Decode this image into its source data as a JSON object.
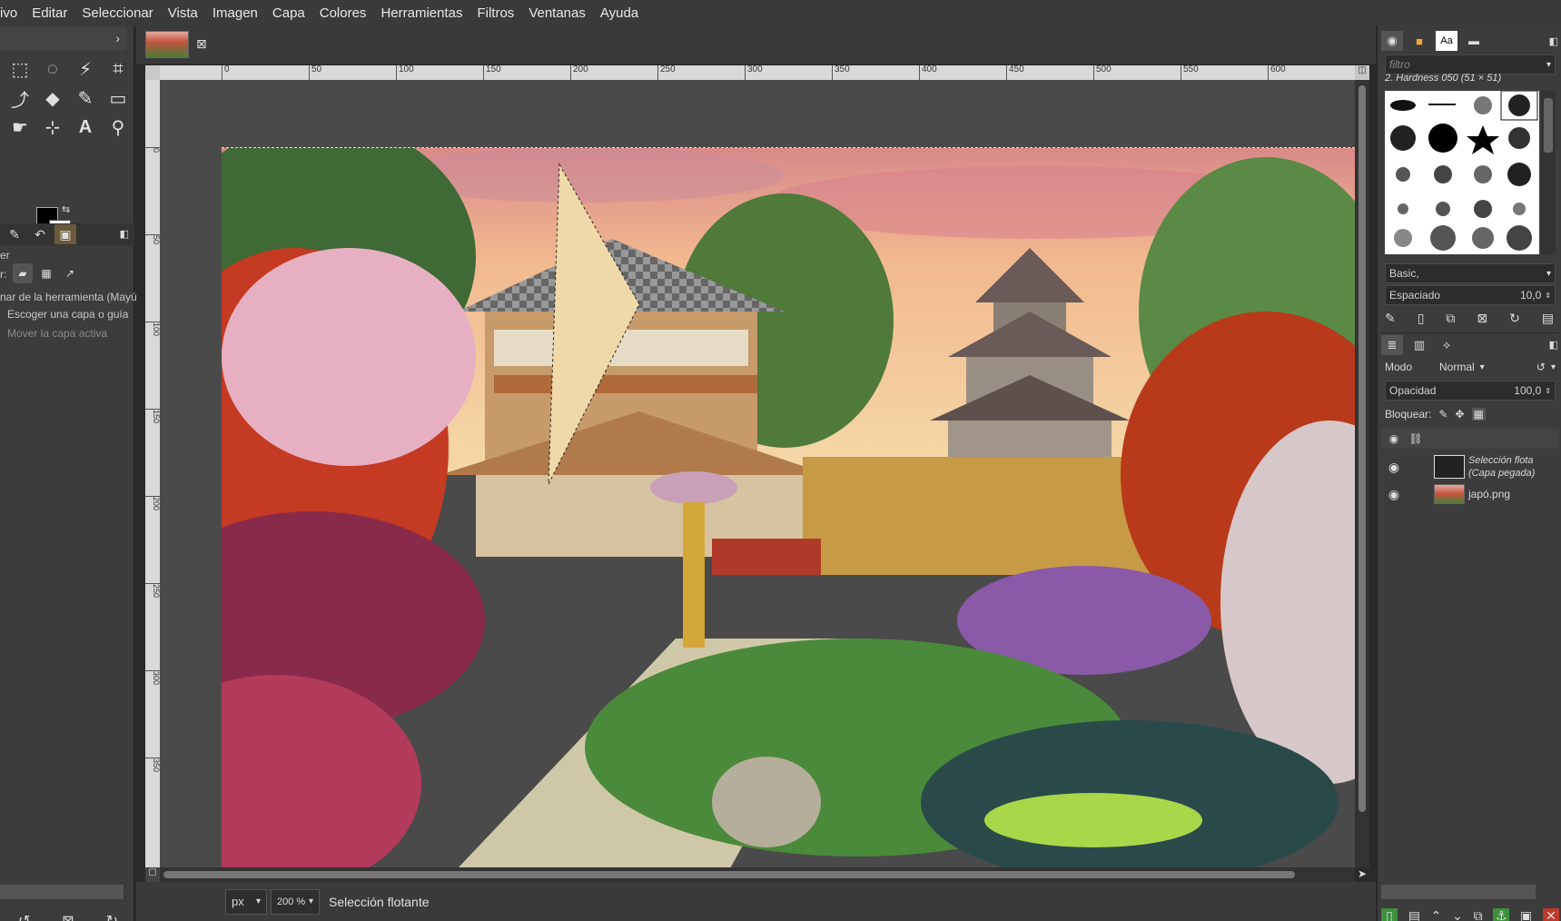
{
  "menu": [
    "ivo",
    "Editar",
    "Seleccionar",
    "Vista",
    "Imagen",
    "Capa",
    "Colores",
    "Herramientas",
    "Filtros",
    "Ventanas",
    "Ayuda"
  ],
  "toolbox": {
    "tools": [
      {
        "name": "rect-select-icon",
        "glyph": "⬚"
      },
      {
        "name": "free-select-icon",
        "glyph": "◌"
      },
      {
        "name": "fuzzy-select-icon",
        "glyph": "⚡"
      },
      {
        "name": "crop-icon",
        "glyph": "⌗"
      },
      {
        "name": "warp-transform-icon",
        "glyph": "⤴"
      },
      {
        "name": "bucket-fill-icon",
        "glyph": "◆"
      },
      {
        "name": "paintbrush-icon",
        "glyph": "✎"
      },
      {
        "name": "eraser-icon",
        "glyph": "▭"
      },
      {
        "name": "smudge-icon",
        "glyph": "☛"
      },
      {
        "name": "paths-icon",
        "glyph": "⊹"
      },
      {
        "name": "text-tool-icon",
        "glyph": "A"
      },
      {
        "name": "color-picker-icon",
        "glyph": "⚲"
      }
    ],
    "options_title": "er",
    "options_label": "r:",
    "option_line1": "nar de la herramienta  (Mayú",
    "option_line2": "Escoger una capa o guía",
    "option_line3": "Mover la capa activa"
  },
  "ruler": {
    "h_labels": [
      "0",
      "50",
      "100",
      "150",
      "200",
      "250",
      "300",
      "350",
      "400",
      "450",
      "500",
      "550",
      "600"
    ],
    "v_labels": [
      "0",
      "50",
      "100",
      "150",
      "200",
      "250",
      "300",
      "350"
    ]
  },
  "status": {
    "unit": "px",
    "zoom": "200 %",
    "message": "Selección flotante"
  },
  "dock": {
    "filter_placeholder": "filtro",
    "brush_name": "2. Hardness 050 (51 × 51)",
    "brush_set": "Basic,",
    "spacing_label": "Espaciado",
    "spacing_value": "10,0",
    "mode_label": "Modo",
    "mode_value": "Normal",
    "opacity_label": "Opacidad",
    "opacity_value": "100,0",
    "lock_label": "Bloquear:",
    "layers": [
      {
        "name_line1": "Selección flota",
        "name_line2": "(Capa pegada)"
      },
      {
        "name_line1": "japó.png",
        "name_line2": ""
      }
    ]
  },
  "colors": {
    "accent": "#3c8f3c",
    "danger": "#c0392b",
    "selection": "#ffeb3b"
  }
}
